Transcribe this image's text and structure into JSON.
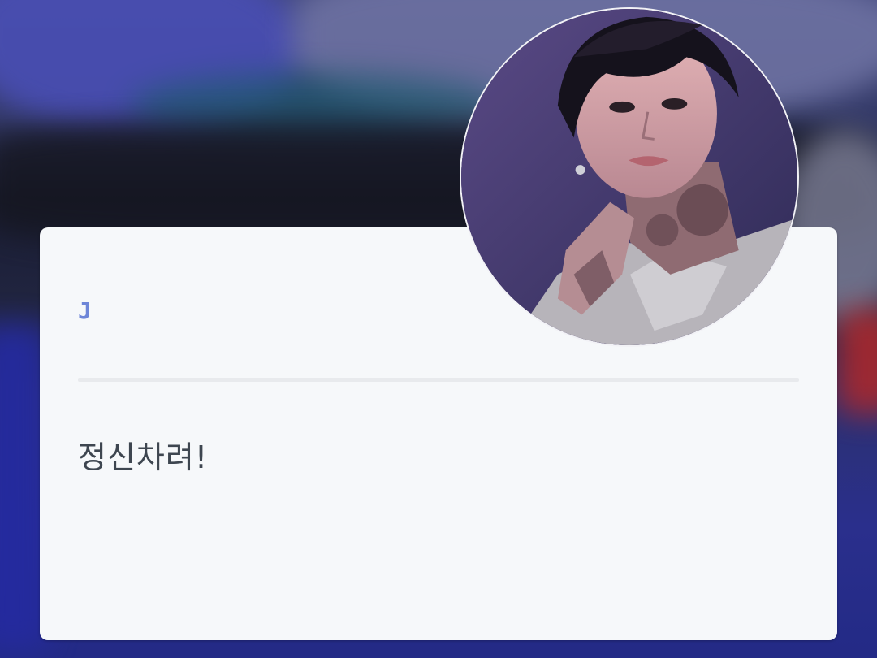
{
  "card": {
    "title": "J",
    "message": "정신차려!"
  },
  "avatar": {
    "description_icon": "profile-photo-icon"
  },
  "colors": {
    "title_accent": "#6e86d8",
    "card_bg": "#f6f8fa",
    "message_text": "#3e4650",
    "divider": "#e8eaed"
  }
}
